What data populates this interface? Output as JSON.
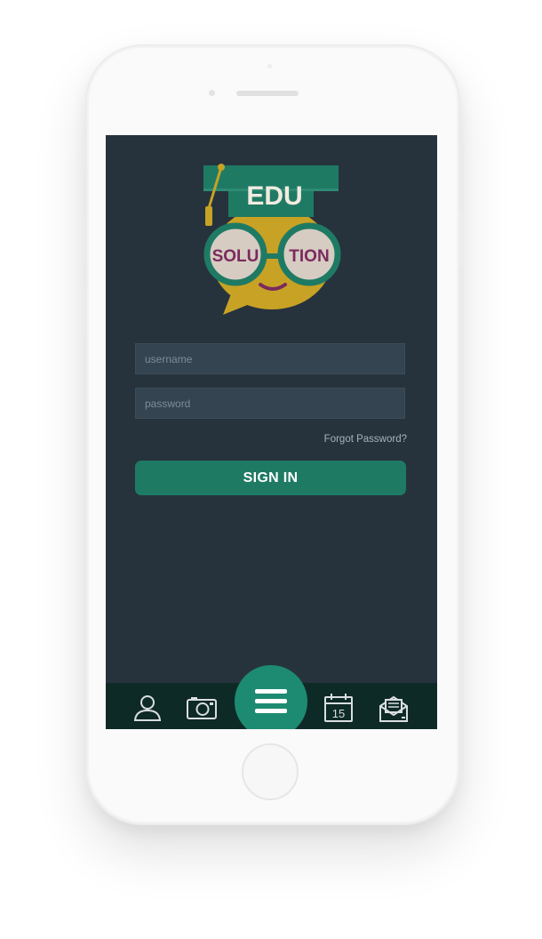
{
  "logo": {
    "cap_text": "EDU",
    "left_lens_text": "SOLU",
    "right_lens_text": "TION"
  },
  "login": {
    "username_placeholder": "username",
    "password_placeholder": "password",
    "forgot_password_label": "Forgot Password?",
    "signin_label": "SIGN IN"
  },
  "bottom_nav": {
    "items": [
      {
        "icon": "user-icon"
      },
      {
        "icon": "camera-icon"
      },
      {
        "icon": "menu-icon"
      },
      {
        "icon": "calendar-icon",
        "text": "15"
      },
      {
        "icon": "mail-icon"
      }
    ]
  },
  "colors": {
    "screen_bg": "#26333d",
    "field_bg": "#344450",
    "accent": "#1f7a64",
    "fab": "#1d8b72",
    "navbar": "#0e2a26",
    "logo_yellow": "#c8a224",
    "logo_green": "#1f7a64",
    "logo_purple": "#7a2a5e"
  }
}
